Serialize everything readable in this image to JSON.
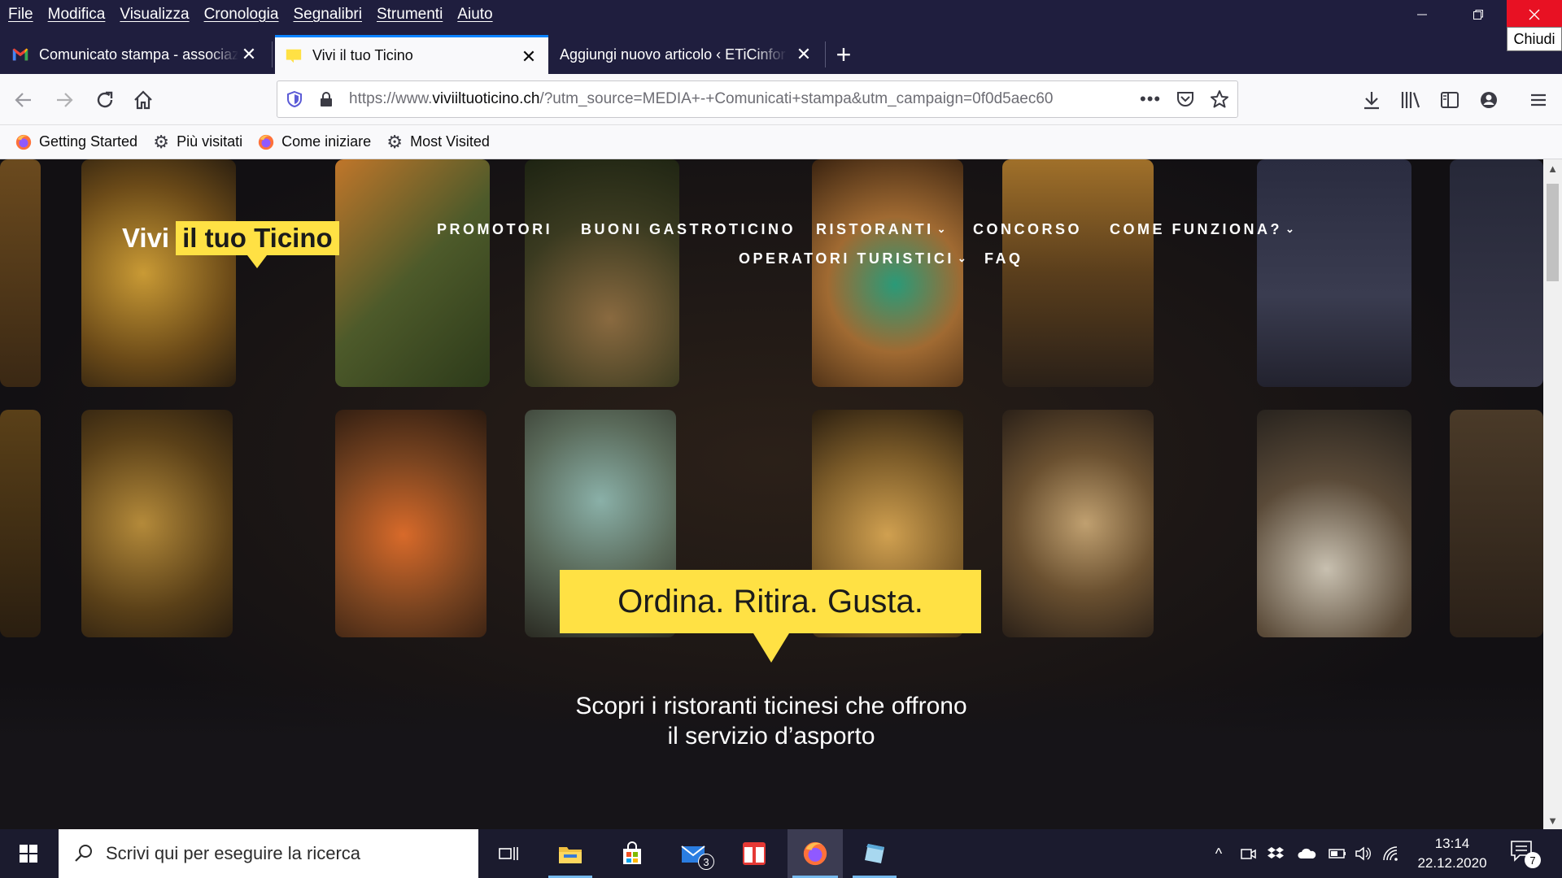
{
  "menubar": {
    "items": [
      "File",
      "Modifica",
      "Visualizza",
      "Cronologia",
      "Segnalibri",
      "Strumenti",
      "Aiuto"
    ],
    "close_tooltip": "Chiudi"
  },
  "tabs": [
    {
      "title": "Comunicato stampa - associazi",
      "icon": "gmail-icon",
      "active": false
    },
    {
      "title": "Vivi il tuo Ticino",
      "icon": "site-favicon",
      "active": true
    },
    {
      "title": "Aggiungi nuovo articolo ‹ ETiCinfor",
      "icon": "",
      "active": false
    }
  ],
  "urlbar": {
    "prefix": "https://www.",
    "domain": "viviiltuoticino.ch",
    "rest": "/?utm_source=MEDIA+-+Comunicati+stampa&utm_campaign=0f0d5aec60"
  },
  "bookmarks": [
    {
      "label": "Getting Started",
      "icon": "firefox-icon"
    },
    {
      "label": "Più visitati",
      "icon": "gear-icon"
    },
    {
      "label": "Come iniziare",
      "icon": "firefox-icon"
    },
    {
      "label": "Most Visited",
      "icon": "gear-icon"
    }
  ],
  "site": {
    "logo_part1": "Vivi",
    "logo_part2": "il tuo Ticino",
    "nav": {
      "promotori": "PROMOTORI",
      "buoni": "BUONI GASTROTICINO",
      "ristoranti": "RISTORANTI",
      "concorso": "CONCORSO",
      "come_funziona": "COME FUNZIONA?",
      "operatori": "OPERATORI TURISTICI",
      "faq": "FAQ"
    },
    "hero_title": "Ordina. Ritira. Gusta.",
    "hero_sub_line1": "Scopri i ristoranti ticinesi che offrono",
    "hero_sub_line2": "il servizio d’asporto",
    "accent": "#ffe144"
  },
  "taskbar": {
    "search_placeholder": "Scrivi qui per eseguire la ricerca",
    "mail_badge": "3",
    "time": "13:14",
    "date": "22.12.2020",
    "notification_count": "7"
  }
}
